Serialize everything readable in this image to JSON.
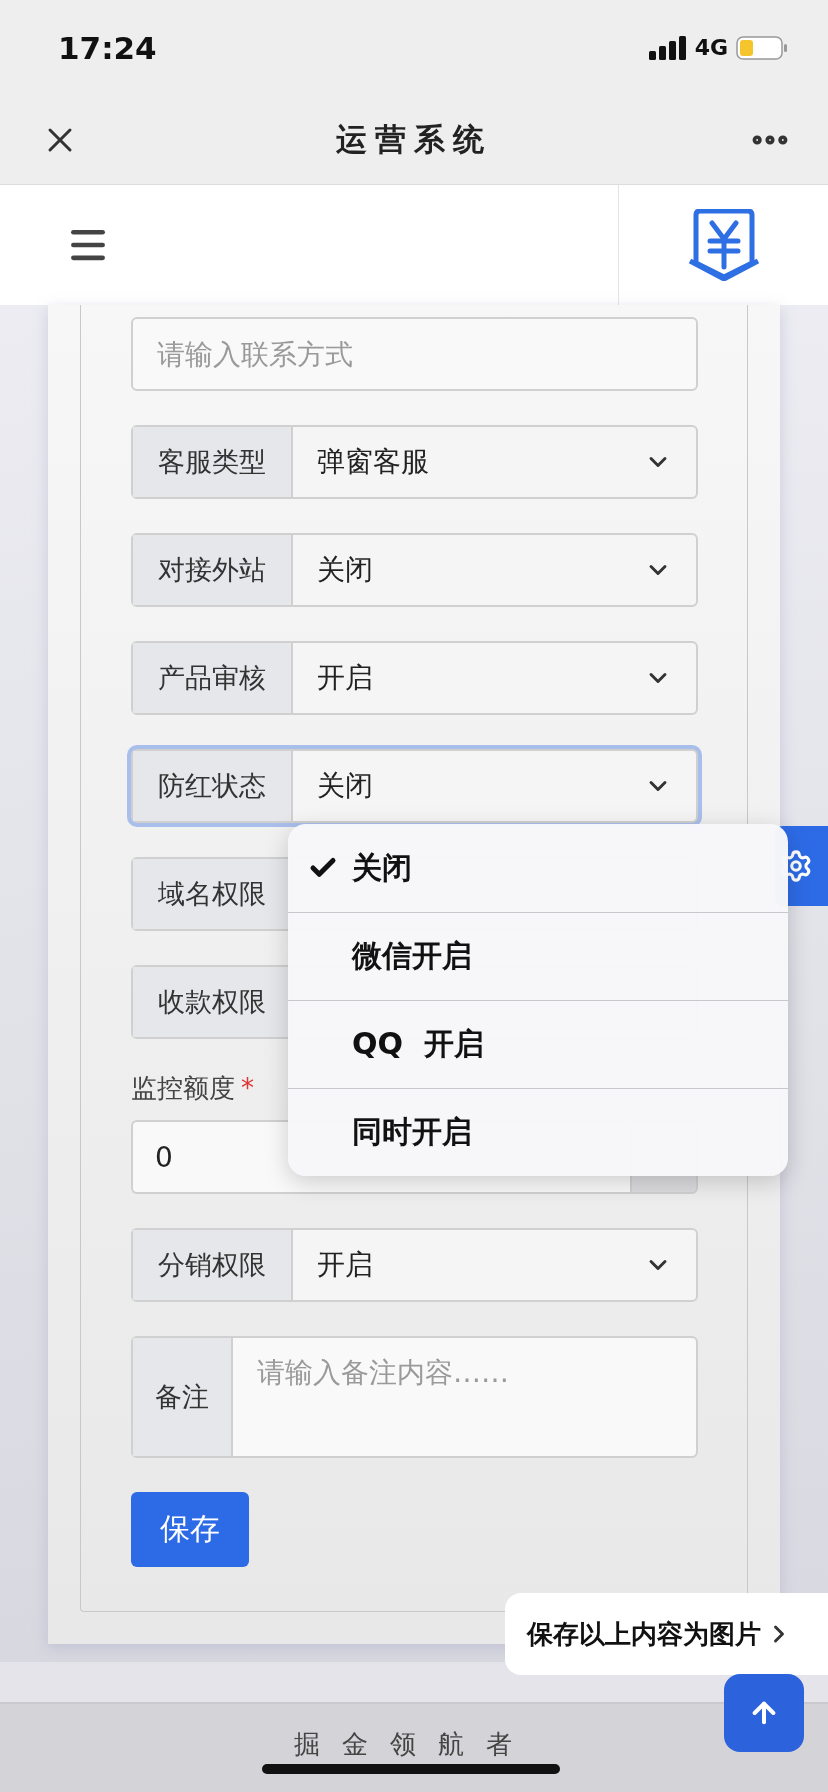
{
  "status_bar": {
    "time": "17:24",
    "network": "4G"
  },
  "nav_bar": {
    "title": "运营系统"
  },
  "form": {
    "fields": [
      {
        "kind": "text",
        "placeholder": "请输入联系方式"
      },
      {
        "kind": "select",
        "label": "客服类型",
        "value": "弹窗客服",
        "focused": false
      },
      {
        "kind": "select",
        "label": "对接外站",
        "value": "关闭",
        "focused": false
      },
      {
        "kind": "select",
        "label": "产品审核",
        "value": "开启",
        "focused": false
      },
      {
        "kind": "select",
        "label": "防红状态",
        "value": "关闭",
        "focused": true
      },
      {
        "kind": "select",
        "label": "域名权限",
        "focused": false
      },
      {
        "kind": "select",
        "label": "收款权限",
        "focused": false
      },
      {
        "kind": "number",
        "label": "监控额度",
        "required_mark": "*",
        "value": "0"
      },
      {
        "kind": "select",
        "label": "分销权限",
        "value": "开启",
        "focused": false
      },
      {
        "kind": "textarea",
        "label": "备注",
        "placeholder": "请输入备注内容……"
      }
    ],
    "save_button": "保存"
  },
  "dropdown": {
    "options": [
      {
        "label": "关闭",
        "selected": true
      },
      {
        "label": "微信开启",
        "selected": false
      },
      {
        "label": "QQ  开启",
        "selected": false
      },
      {
        "label": "同时开启",
        "selected": false
      }
    ]
  },
  "save_image_prompt": "保存以上内容为图片",
  "footer": "掘金领航者"
}
